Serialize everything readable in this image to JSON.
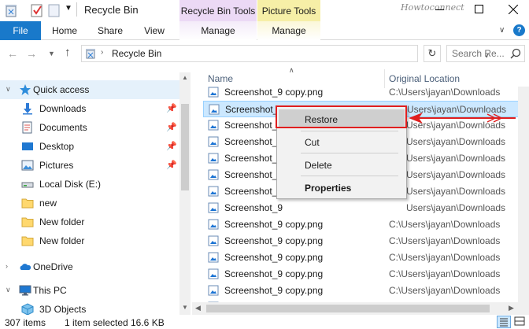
{
  "titlebar": {
    "title": "Recycle Bin",
    "context_tab_recycle": "Recycle Bin Tools",
    "context_tab_picture": "Picture Tools",
    "watermark": "Howtoconnect"
  },
  "ribbon": {
    "file": "File",
    "home": "Home",
    "share": "Share",
    "view": "View",
    "manage_recycle": "Manage",
    "manage_picture": "Manage",
    "help": "?"
  },
  "address": {
    "path": "Recycle Bin",
    "search_placeholder": "Search Re..."
  },
  "nav_pane": {
    "items": [
      {
        "label": "Quick access",
        "icon": "star-icon",
        "pinned": false
      },
      {
        "label": "Downloads",
        "icon": "download-icon",
        "pinned": true
      },
      {
        "label": "Documents",
        "icon": "documents-icon",
        "pinned": true
      },
      {
        "label": "Desktop",
        "icon": "desktop-icon",
        "pinned": true
      },
      {
        "label": "Pictures",
        "icon": "pictures-icon",
        "pinned": true
      },
      {
        "label": "Local Disk (E:)",
        "icon": "drive-icon",
        "pinned": false
      },
      {
        "label": "new",
        "icon": "folder-icon",
        "pinned": false
      },
      {
        "label": "New folder",
        "icon": "folder-icon",
        "pinned": false
      },
      {
        "label": "New folder",
        "icon": "folder-icon",
        "pinned": false
      },
      {
        "label": "OneDrive",
        "icon": "onedrive-icon",
        "pinned": false
      },
      {
        "label": "This PC",
        "icon": "computer-icon",
        "pinned": false
      },
      {
        "label": "3D Objects",
        "icon": "cube-icon",
        "pinned": false
      }
    ]
  },
  "file_list": {
    "columns": {
      "name": "Name",
      "location": "Original Location"
    },
    "rows": [
      {
        "name": "Screenshot_9 copy.png",
        "location": "C:\\Users\\jayan\\Downloads"
      },
      {
        "name": "Screenshot_9",
        "location": "Users\\jayan\\Downloads"
      },
      {
        "name": "Screenshot_9",
        "location": "Users\\jayan\\Downloads"
      },
      {
        "name": "Screenshot_9",
        "location": "Users\\jayan\\Downloads"
      },
      {
        "name": "Screenshot_9",
        "location": "Users\\jayan\\Downloads"
      },
      {
        "name": "Screenshot_9",
        "location": "Users\\jayan\\Downloads"
      },
      {
        "name": "Screenshot_9",
        "location": "Users\\jayan\\Downloads"
      },
      {
        "name": "Screenshot_9",
        "location": "Users\\jayan\\Downloads"
      },
      {
        "name": "Screenshot_9 copy.png",
        "location": "C:\\Users\\jayan\\Downloads"
      },
      {
        "name": "Screenshot_9 copy.png",
        "location": "C:\\Users\\jayan\\Downloads"
      },
      {
        "name": "Screenshot_9 copy.png",
        "location": "C:\\Users\\jayan\\Downloads"
      },
      {
        "name": "Screenshot_9 copy.png",
        "location": "C:\\Users\\jayan\\Downloads"
      },
      {
        "name": "Screenshot_9 copy.png",
        "location": "C:\\Users\\jayan\\Downloads"
      },
      {
        "name": "Screenshot_9 copy.png",
        "location": "C:\\Users\\jayan\\Downloads"
      }
    ]
  },
  "context_menu": {
    "restore": "Restore",
    "cut": "Cut",
    "delete": "Delete",
    "properties": "Properties"
  },
  "status": {
    "items": "307 items",
    "selected": "1 item selected",
    "size": "16.6 KB"
  },
  "colors": {
    "accent": "#1979ca",
    "selection": "#cce8ff",
    "annotation": "#e01f1f",
    "recycle_tools": "#ecd9f5",
    "picture_tools": "#f6efa7"
  }
}
